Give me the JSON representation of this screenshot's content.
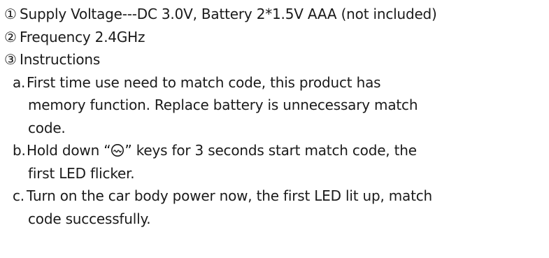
{
  "specs": [
    {
      "mark": "①",
      "text": "Supply Voltage---DC 3.0V, Battery  2*1.5V AAA (not included)"
    },
    {
      "mark": "②",
      "text": "Frequency 2.4GHz"
    },
    {
      "mark": "③",
      "text": "Instructions"
    }
  ],
  "steps": {
    "a": {
      "letter": "a.",
      "line1": "First time use need to match code, this product has",
      "line2": "memory function. Replace battery is unnecessary match",
      "line3": "code."
    },
    "b": {
      "letter": "b.",
      "pre": "Hold down “",
      "icon": "wave-in-circle-icon",
      "post": "”  keys for 3 seconds  start match code, the",
      "line2": "first LED flicker."
    },
    "c": {
      "letter": "c.",
      "line1": "Turn on the car body power now, the first LED lit up, match",
      "line2": "code successfully."
    }
  }
}
